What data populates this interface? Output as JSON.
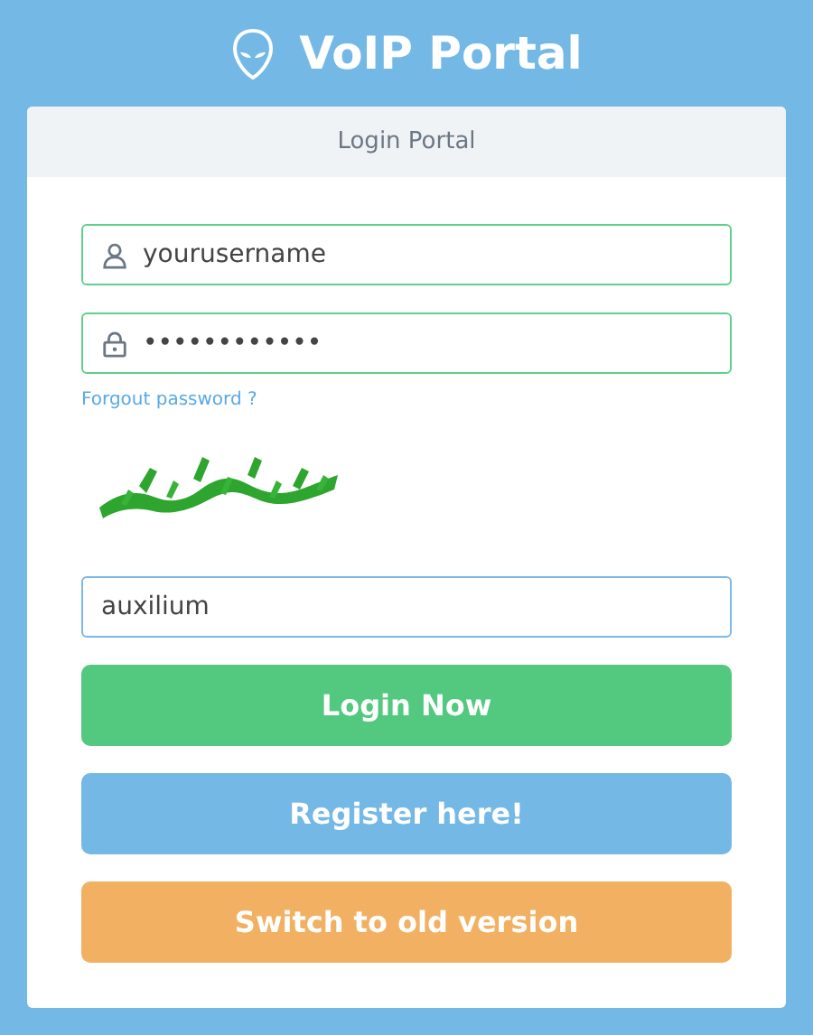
{
  "header": {
    "title": "VoIP Portal"
  },
  "card": {
    "title": "Login Portal"
  },
  "fields": [
    {
      "kind": "user",
      "value": "yourusername",
      "focused": false
    },
    {
      "kind": "password",
      "value": "••••••••••••",
      "focused": false
    }
  ],
  "forgot_link": "Forgout password ?",
  "captcha_field": {
    "value": "auxilium",
    "focused": true
  },
  "buttons": [
    {
      "label": "Login Now",
      "kind": "success"
    },
    {
      "label": "Register here!",
      "kind": "info"
    },
    {
      "label": "Switch to old version",
      "kind": "warning"
    }
  ]
}
